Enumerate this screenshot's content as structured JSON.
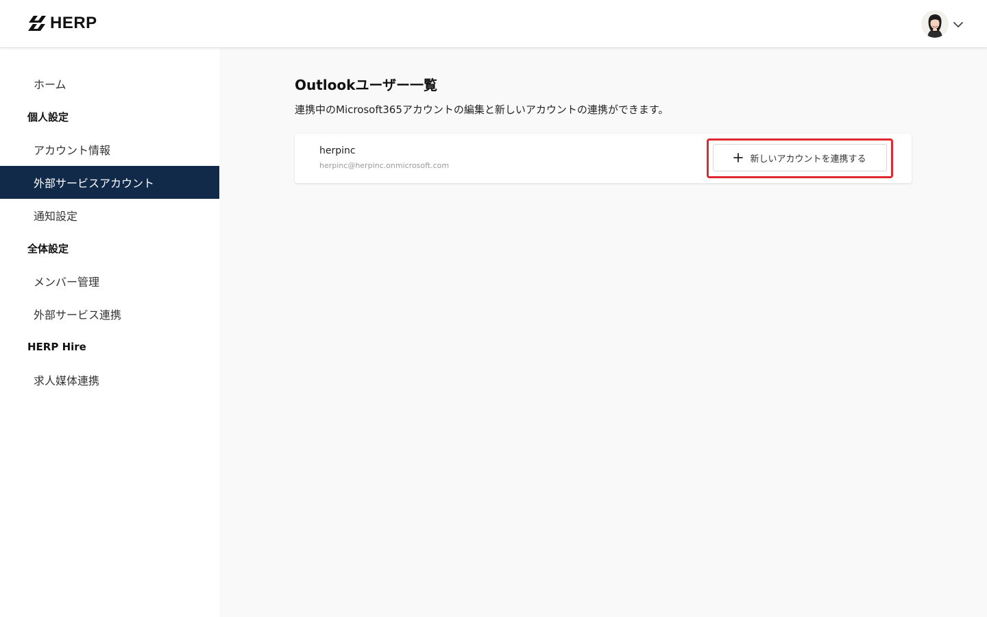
{
  "header": {
    "logo_text": "HERP",
    "avatar_icon": "user-avatar",
    "menu_icon": "chevron-down-icon"
  },
  "sidebar": {
    "items": [
      {
        "type": "item",
        "label": "ホーム"
      },
      {
        "type": "section",
        "label": "個人設定"
      },
      {
        "type": "item",
        "label": "アカウント情報"
      },
      {
        "type": "item",
        "label": "外部サービスアカウント",
        "active": true
      },
      {
        "type": "item",
        "label": "通知設定"
      },
      {
        "type": "section",
        "label": "全体設定"
      },
      {
        "type": "item",
        "label": "メンバー管理"
      },
      {
        "type": "item",
        "label": "外部サービス連携"
      },
      {
        "type": "section",
        "label": "HERP Hire"
      },
      {
        "type": "item",
        "label": "求人媒体連携"
      }
    ]
  },
  "main": {
    "title": "Outlookユーザー一覧",
    "description": "連携中のMicrosoft365アカウントの編集と新しいアカウントの連携ができます。",
    "accounts": [
      {
        "name": "herpinc",
        "email": "herpinc@herpinc.onmicrosoft.com"
      }
    ],
    "add_button": {
      "label": "新しいアカウントを連携する",
      "icon": "plus-icon"
    }
  },
  "colors": {
    "active_nav_bg": "#112a4a",
    "highlight_border": "#e0282e",
    "page_bg": "#f9f9f9"
  }
}
